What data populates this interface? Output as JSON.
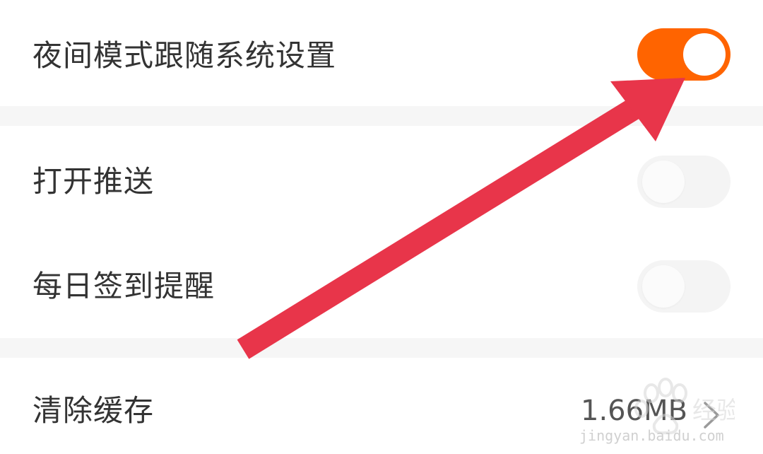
{
  "settings": {
    "night_mode": {
      "label": "夜间模式跟随系统设置",
      "enabled": true
    },
    "push": {
      "label": "打开推送",
      "enabled": false
    },
    "checkin_reminder": {
      "label": "每日签到提醒",
      "enabled": false
    },
    "clear_cache": {
      "label": "清除缓存",
      "value": "1.66MB"
    }
  },
  "watermark": {
    "text": "jingyan.baidu.com",
    "brand": "Bai 经验"
  },
  "colors": {
    "accent": "#ff6400",
    "annotation_arrow": "#e8354a",
    "text": "#333333",
    "divider": "#f6f6f6",
    "toggle_off": "#f4f4f4"
  },
  "icons": {
    "chevron": "chevron-right-icon",
    "annotation": "arrow-annotation-icon",
    "watermark": "paw-logo-icon"
  }
}
